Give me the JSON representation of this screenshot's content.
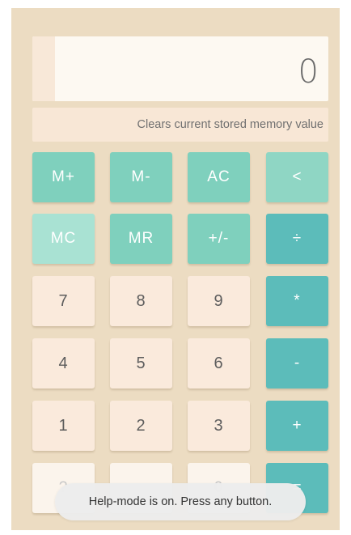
{
  "display": {
    "value": "0"
  },
  "help_bar": {
    "text": "Clears current stored memory value"
  },
  "keys": {
    "row1": [
      "M+",
      "M-",
      "AC",
      "<"
    ],
    "row2": [
      "MC",
      "MR",
      "+/-",
      "÷"
    ],
    "row3": [
      "7",
      "8",
      "9",
      "*"
    ],
    "row4": [
      "4",
      "5",
      "6",
      "-"
    ],
    "row5": [
      "1",
      "2",
      "3",
      "+"
    ],
    "row6": [
      "?",
      "",
      "0",
      "="
    ]
  },
  "toast": {
    "message": "Help-mode is on. Press any button."
  },
  "colors": {
    "background": "#ecdcc2",
    "memory_key": "#7fd0bd",
    "memory_key_selected": "#a9e2d3",
    "operator_key": "#5cbcba",
    "number_key": "#faeadc"
  }
}
